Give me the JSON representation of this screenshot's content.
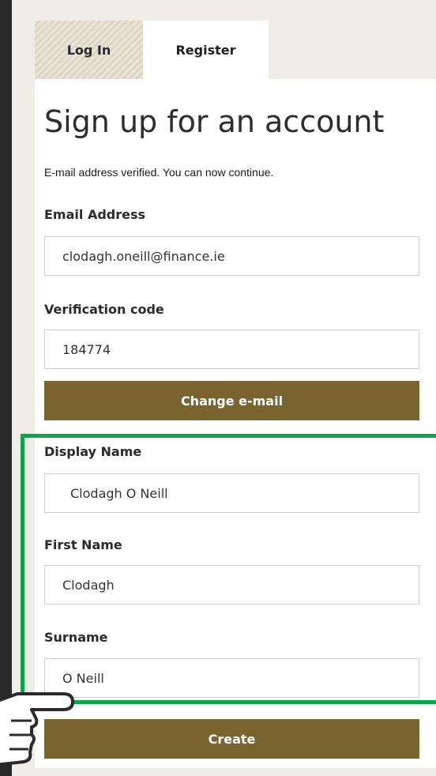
{
  "tabs": {
    "login": "Log In",
    "register": "Register"
  },
  "form": {
    "title": "Sign up for an account",
    "verified_message": "E-mail address verified. You can now continue.",
    "email": {
      "label": "Email Address",
      "value": "clodagh.oneill@finance.ie"
    },
    "verification": {
      "label": "Verification code",
      "value": "184774"
    },
    "change_email_button": "Change e-mail",
    "display_name": {
      "label": "Display Name",
      "value": "Clodagh O Neill"
    },
    "first_name": {
      "label": "First Name",
      "value": "Clodagh"
    },
    "surname": {
      "label": "Surname",
      "value": "O Neill"
    },
    "create_button": "Create"
  },
  "colors": {
    "accent": "#7a6530",
    "highlight": "#0aa64a"
  },
  "icons": {
    "pointer": "pointing-hand-icon"
  }
}
